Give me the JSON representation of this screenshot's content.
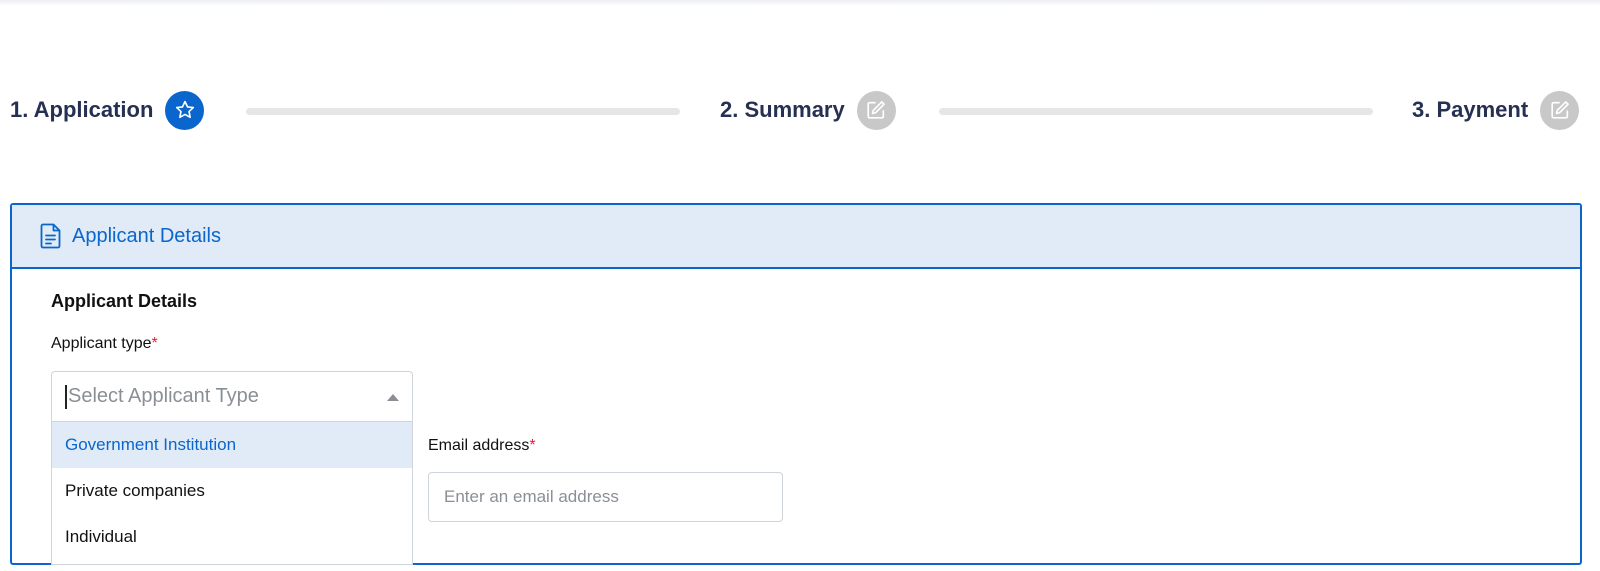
{
  "stepper": {
    "steps": [
      {
        "label": "1. Application",
        "icon": "star-icon",
        "state": "active"
      },
      {
        "label": "2. Summary",
        "icon": "edit-icon",
        "state": "inactive"
      },
      {
        "label": "3. Payment",
        "icon": "edit-icon",
        "state": "inactive"
      }
    ]
  },
  "card": {
    "header_icon": "document-icon",
    "header_title": "Applicant Details",
    "section_title": "Applicant Details",
    "applicant_type": {
      "label": "Applicant type",
      "required_marker": "*",
      "placeholder": "Select Applicant Type",
      "options": [
        "Government Institution",
        "Private companies",
        "Individual"
      ],
      "highlighted_option": "Government Institution"
    },
    "email": {
      "label": "Email address",
      "required_marker": "*",
      "placeholder": "Enter an email address",
      "value": ""
    }
  },
  "colors": {
    "primary": "#0a66cc",
    "header_bg": "#e0ebf7",
    "inactive_step": "#c8c8c8",
    "required": "#e0203a"
  }
}
